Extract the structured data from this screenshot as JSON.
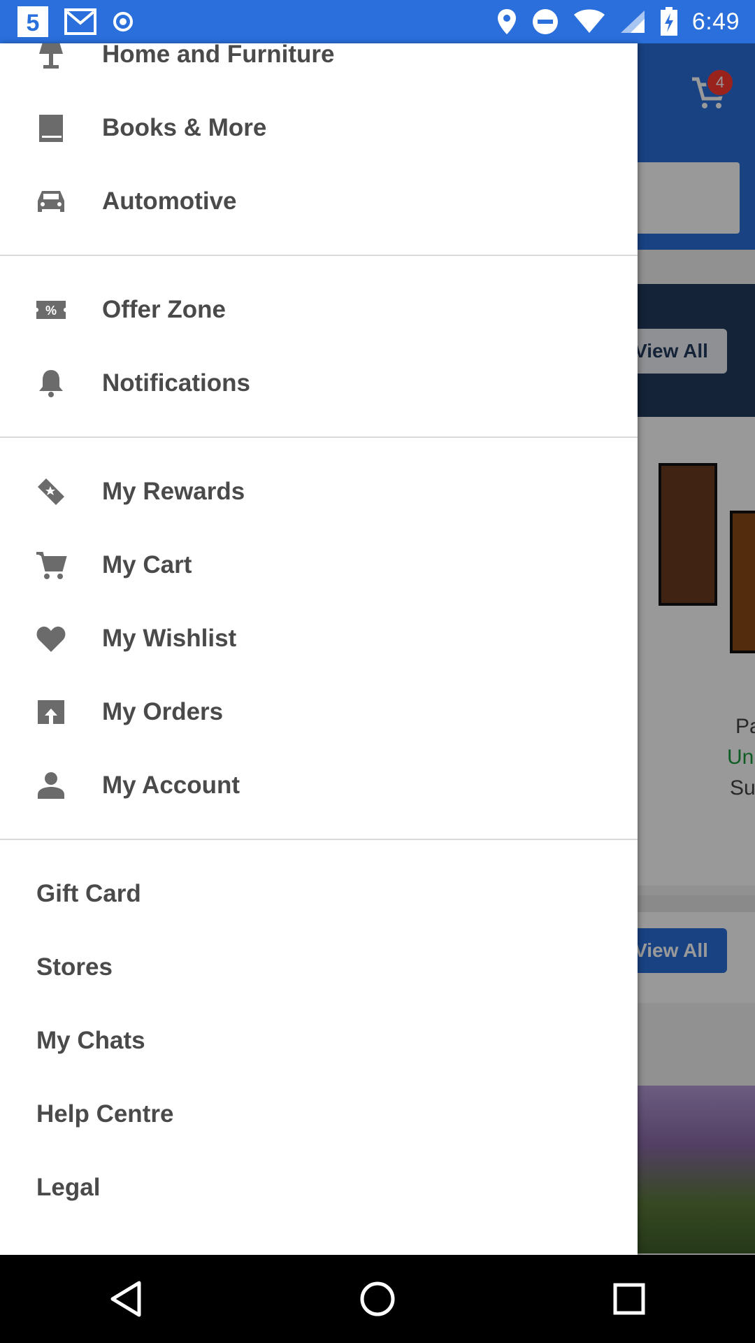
{
  "status_bar": {
    "time": "6:49",
    "left_icons": [
      "channel-5-app-icon",
      "gmail-icon",
      "sync-icon"
    ],
    "right_icons": [
      "location-icon",
      "do-not-disturb-icon",
      "wifi-icon",
      "signal-icon",
      "battery-charging-icon"
    ]
  },
  "background_app": {
    "cart_count": "4",
    "view_all_1": "View All",
    "view_all_2": "View All",
    "product_text_1": "Pa",
    "product_text_2": "Un",
    "product_text_3": "Su"
  },
  "drawer": {
    "group1": [
      {
        "label": "Home and Furniture",
        "icon": "lamp-icon"
      },
      {
        "label": "Books & More",
        "icon": "book-icon"
      },
      {
        "label": "Automotive",
        "icon": "car-icon"
      }
    ],
    "group2": [
      {
        "label": "Offer Zone",
        "icon": "offer-ticket-icon"
      },
      {
        "label": "Notifications",
        "icon": "bell-icon"
      }
    ],
    "group3": [
      {
        "label": "My Rewards",
        "icon": "rewards-tag-icon"
      },
      {
        "label": "My Cart",
        "icon": "cart-icon"
      },
      {
        "label": "My Wishlist",
        "icon": "heart-icon"
      },
      {
        "label": "My Orders",
        "icon": "orders-box-icon"
      },
      {
        "label": "My Account",
        "icon": "person-icon"
      }
    ],
    "group4": [
      {
        "label": "Gift Card"
      },
      {
        "label": "Stores"
      },
      {
        "label": "My Chats"
      },
      {
        "label": "Help Centre"
      },
      {
        "label": "Legal"
      }
    ]
  },
  "colors": {
    "brand_blue": "#2a6fdb",
    "menu_text": "#4a4a4a",
    "icon_gray": "#6b6b6b"
  }
}
